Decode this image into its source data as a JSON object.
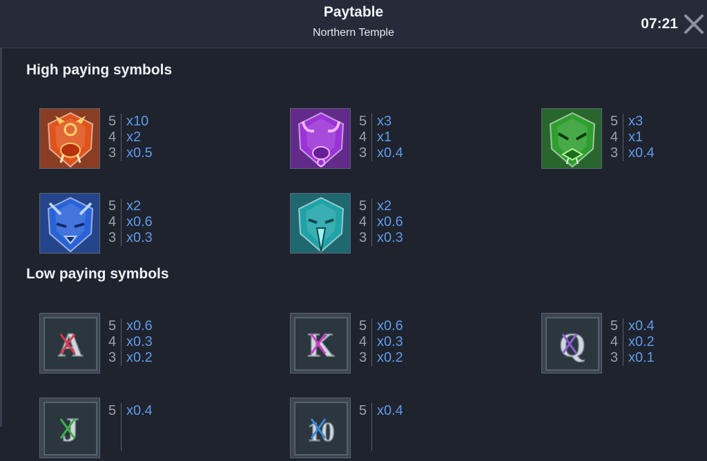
{
  "header": {
    "title": "Paytable",
    "subtitle": "Northern Temple",
    "clock": "07:21"
  },
  "sections": {
    "high_title": "High paying symbols",
    "low_title": "Low paying symbols"
  },
  "high_symbols": [
    {
      "icon": "boar-mask-icon",
      "color": "#e0541c",
      "pays": [
        {
          "count": "5",
          "mult": "x10"
        },
        {
          "count": "4",
          "mult": "x2"
        },
        {
          "count": "3",
          "mult": "x0.5"
        }
      ]
    },
    {
      "icon": "bull-mask-icon",
      "color": "#9b33d6",
      "pays": [
        {
          "count": "5",
          "mult": "x3"
        },
        {
          "count": "4",
          "mult": "x1"
        },
        {
          "count": "3",
          "mult": "x0.4"
        }
      ]
    },
    {
      "icon": "serpent-mask-icon",
      "color": "#2f9e2f",
      "pays": [
        {
          "count": "5",
          "mult": "x3"
        },
        {
          "count": "4",
          "mult": "x1"
        },
        {
          "count": "3",
          "mult": "x0.4"
        }
      ]
    },
    {
      "icon": "wolf-mask-icon",
      "color": "#2a62d8",
      "pays": [
        {
          "count": "5",
          "mult": "x2"
        },
        {
          "count": "4",
          "mult": "x0.6"
        },
        {
          "count": "3",
          "mult": "x0.3"
        }
      ]
    },
    {
      "icon": "eagle-mask-icon",
      "color": "#1fa3a8",
      "pays": [
        {
          "count": "5",
          "mult": "x2"
        },
        {
          "count": "4",
          "mult": "x0.6"
        },
        {
          "count": "3",
          "mult": "x0.3"
        }
      ]
    }
  ],
  "low_symbols": [
    {
      "icon": "letter-a-icon",
      "letter": "A",
      "rune_color": "#e0384c",
      "pays": [
        {
          "count": "5",
          "mult": "x0.6"
        },
        {
          "count": "4",
          "mult": "x0.3"
        },
        {
          "count": "3",
          "mult": "x0.2"
        }
      ]
    },
    {
      "icon": "letter-k-icon",
      "letter": "K",
      "rune_color": "#d23ad0",
      "pays": [
        {
          "count": "5",
          "mult": "x0.6"
        },
        {
          "count": "4",
          "mult": "x0.3"
        },
        {
          "count": "3",
          "mult": "x0.2"
        }
      ]
    },
    {
      "icon": "letter-q-icon",
      "letter": "Q",
      "rune_color": "#8e5fd6",
      "pays": [
        {
          "count": "5",
          "mult": "x0.4"
        },
        {
          "count": "4",
          "mult": "x0.2"
        },
        {
          "count": "3",
          "mult": "x0.1"
        }
      ]
    },
    {
      "icon": "letter-j-icon",
      "letter": "J",
      "rune_color": "#3ab24a",
      "pays": [
        {
          "count": "5",
          "mult": "x0.4"
        }
      ]
    },
    {
      "icon": "number-10-icon",
      "letter": "10",
      "rune_color": "#3a8bd6",
      "pays": [
        {
          "count": "5",
          "mult": "x0.4"
        }
      ]
    }
  ]
}
